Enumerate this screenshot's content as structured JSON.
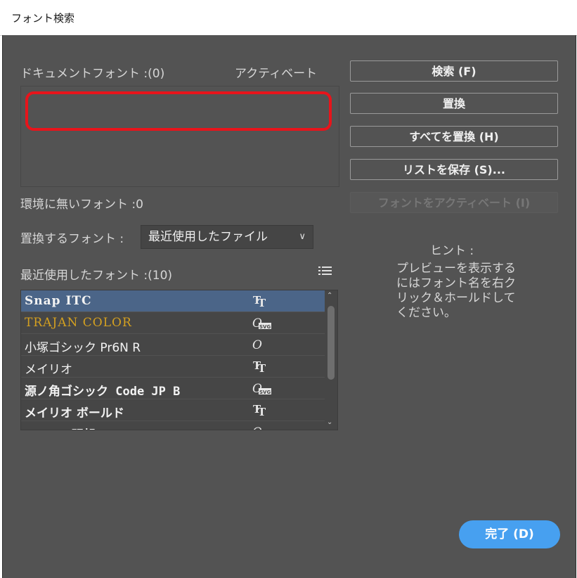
{
  "window": {
    "title": "フォント検索"
  },
  "doc_fonts": {
    "label": "ドキュメントフォント :(0)",
    "activate_label": "アクティベート"
  },
  "buttons": {
    "find": "検索 (F)",
    "replace": "置換",
    "replace_all": "すべてを置換 (H)",
    "save_list": "リストを保存 (S)...",
    "activate_fonts": "フォントをアクティベート (I)"
  },
  "missing_fonts": {
    "label": "環境に無いフォント :0"
  },
  "replace_with": {
    "label": "置換するフォント :",
    "selected": "最近使用したファイル"
  },
  "recent_fonts": {
    "label": "最近使用したフォント :(10)",
    "items": [
      {
        "name": "Snap ITC",
        "type": "truetype",
        "selected": true
      },
      {
        "name": "TRAJAN COLOR",
        "type": "opentype-svg",
        "selected": false
      },
      {
        "name": "小塚ゴシック Pr6N R",
        "type": "opentype",
        "selected": false
      },
      {
        "name": "メイリオ",
        "type": "truetype",
        "selected": false
      },
      {
        "name": "源ノ角ゴシック Code JP B",
        "type": "opentype-svg",
        "selected": false
      },
      {
        "name": "メイリオ ボールド",
        "type": "truetype",
        "selected": false
      },
      {
        "name": "Adobe 明朝 Std L",
        "type": "opentype",
        "selected": false
      }
    ]
  },
  "hint": {
    "title": "ヒント :",
    "text": "プレビューを表示するにはフォント名を右クリック＆ホールドしてください。"
  },
  "done_button": "完了 (D)",
  "colors": {
    "accent": "#47a0f0",
    "highlight": "#e8141b",
    "selection": "#4b6588",
    "panel": "#535353"
  }
}
